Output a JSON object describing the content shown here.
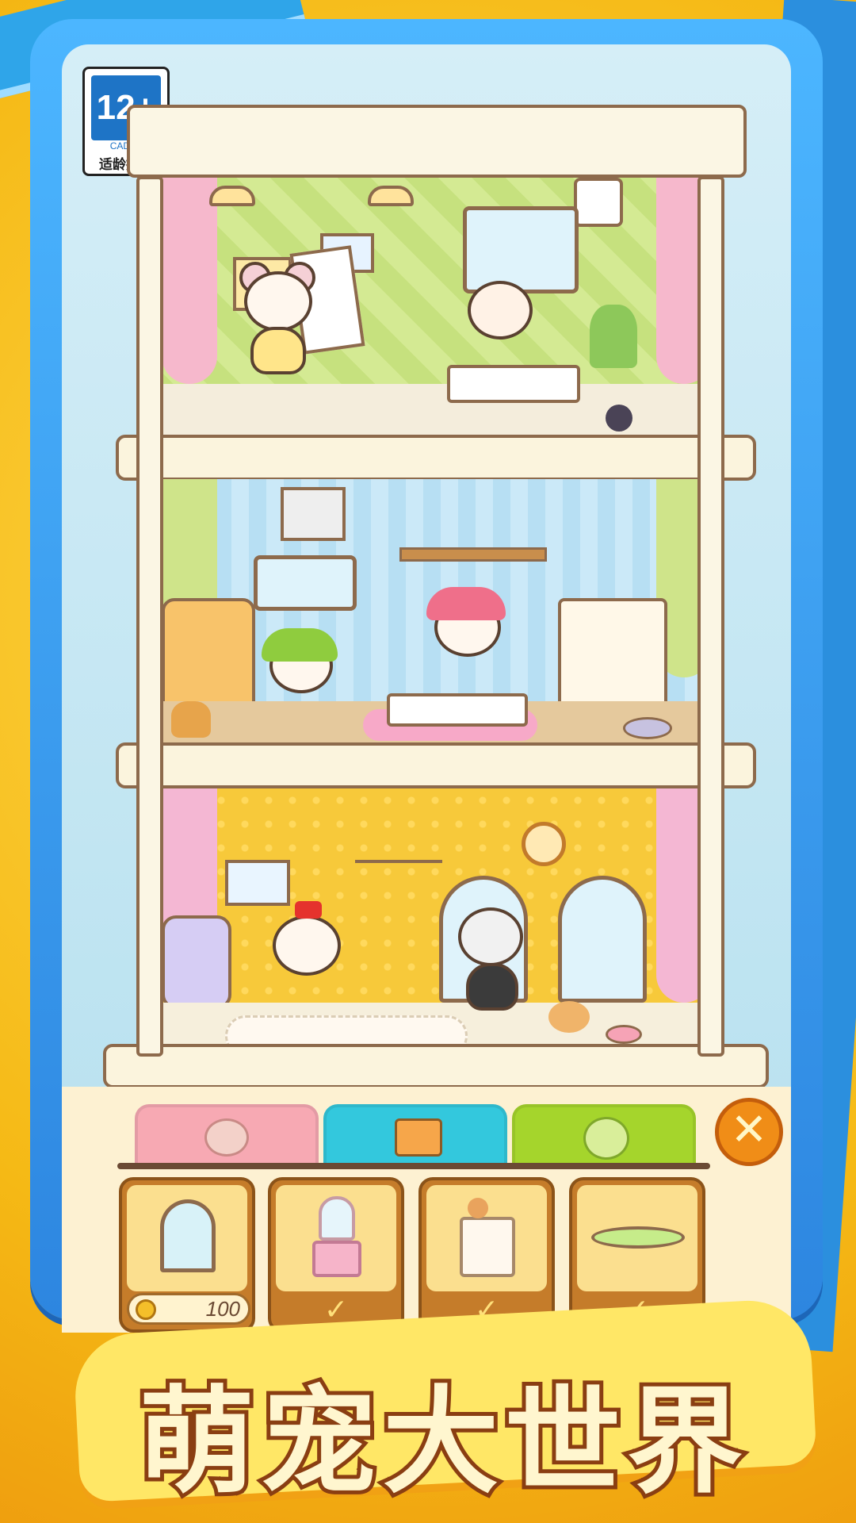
{
  "age_rating": {
    "label": "12+",
    "org": "CADPA",
    "tip": "适龄提示"
  },
  "building": {
    "rooms": [
      "art-room",
      "kitchen",
      "living-room"
    ]
  },
  "shop": {
    "tabs": [
      {
        "name": "pets",
        "icon": "hamster-icon",
        "color": "#f7a9b3",
        "selected": false
      },
      {
        "name": "furniture",
        "icon": "dresser-icon",
        "color": "#33c8dd",
        "selected": true
      },
      {
        "name": "upgrade",
        "icon": "hamster-upgrade-icon",
        "color": "#a5d52c",
        "selected": false
      }
    ],
    "close_icon": "✕",
    "items": [
      {
        "icon": "arched-window-icon",
        "price": "100",
        "owned": false
      },
      {
        "icon": "vanity-mirror-icon",
        "owned": true,
        "mark": "✓"
      },
      {
        "icon": "dresser-icon",
        "owned": true,
        "mark": "✓"
      },
      {
        "icon": "oval-rug-icon",
        "owned": true,
        "mark": "✓"
      }
    ]
  },
  "title": "萌宠大世界",
  "colors": {
    "frame": "#2d86e0",
    "accent_orange": "#f08d17",
    "title_stroke": "#8a3e12"
  }
}
